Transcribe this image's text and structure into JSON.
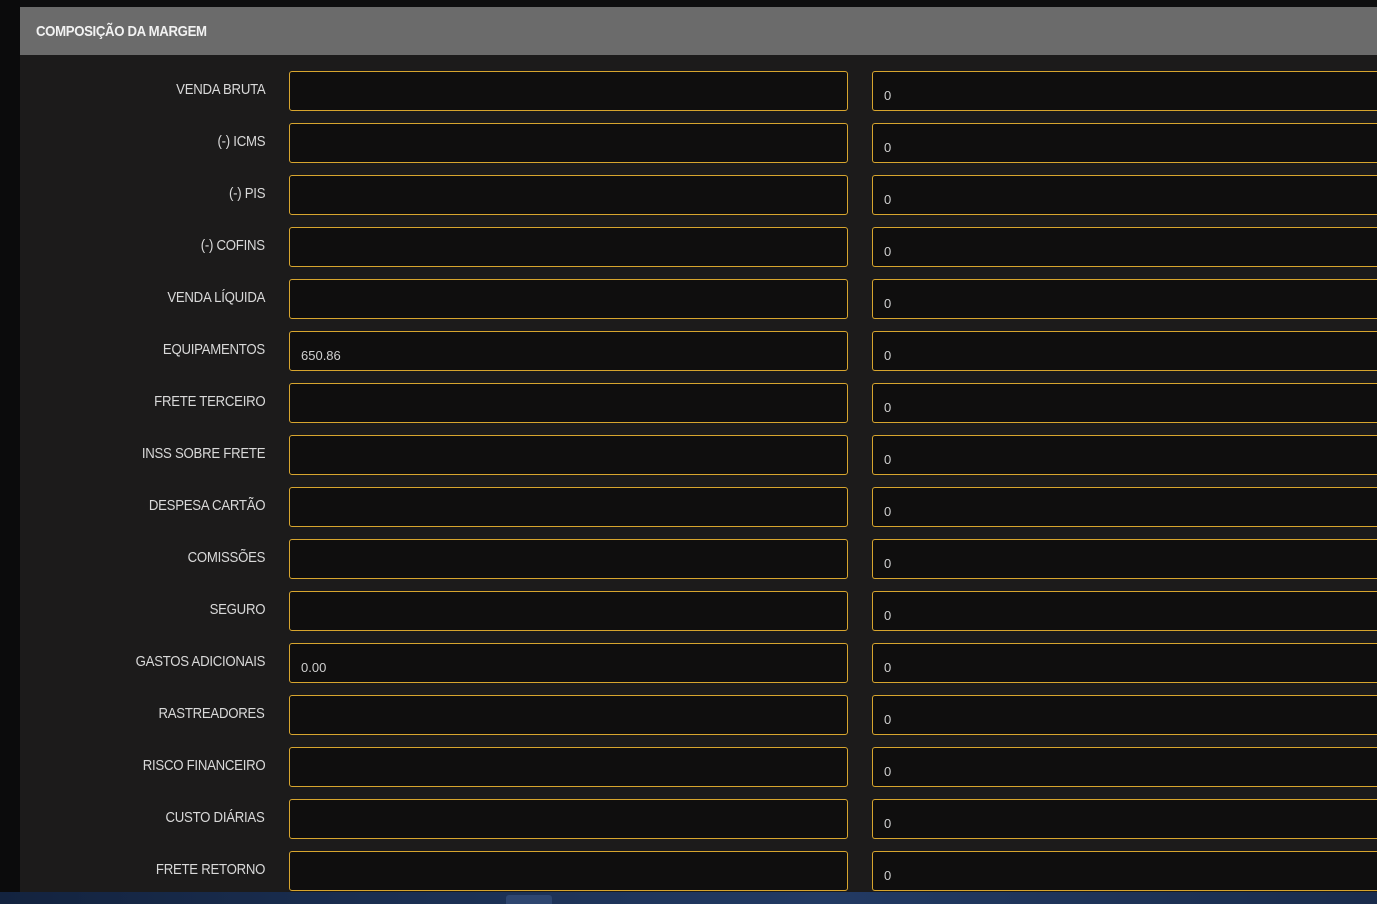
{
  "panel": {
    "title": "COMPOSIÇÃO DA MARGEM"
  },
  "rows": [
    {
      "label": "VENDA BRUTA",
      "main_value": "",
      "side_value": "0"
    },
    {
      "label": "(-) ICMS",
      "main_value": "",
      "side_value": "0"
    },
    {
      "label": "(-) PIS",
      "main_value": "",
      "side_value": "0"
    },
    {
      "label": "(-) COFINS",
      "main_value": "",
      "side_value": "0"
    },
    {
      "label": "VENDA LÍQUIDA",
      "main_value": "",
      "side_value": "0"
    },
    {
      "label": "EQUIPAMENTOS",
      "main_value": "650.86",
      "side_value": "0"
    },
    {
      "label": "FRETE TERCEIRO",
      "main_value": "",
      "side_value": "0"
    },
    {
      "label": "INSS SOBRE FRETE",
      "main_value": "",
      "side_value": "0"
    },
    {
      "label": "DESPESA CARTÃO",
      "main_value": "",
      "side_value": "0"
    },
    {
      "label": "COMISSÕES",
      "main_value": "",
      "side_value": "0"
    },
    {
      "label": "SEGURO",
      "main_value": "",
      "side_value": "0"
    },
    {
      "label": "GASTOS ADICIONAIS",
      "main_value": "0.00",
      "side_value": "0"
    },
    {
      "label": "RASTREADORES",
      "main_value": "",
      "side_value": "0"
    },
    {
      "label": "RISCO FINANCEIRO",
      "main_value": "",
      "side_value": "0"
    },
    {
      "label": "CUSTO DIÁRIAS",
      "main_value": "",
      "side_value": "0"
    },
    {
      "label": "FRETE RETORNO",
      "main_value": "",
      "side_value": "0"
    }
  ],
  "colors": {
    "field_border": "#d7a52e",
    "panel_background": "#1c1b1b",
    "header_background": "#6b6b6b"
  }
}
